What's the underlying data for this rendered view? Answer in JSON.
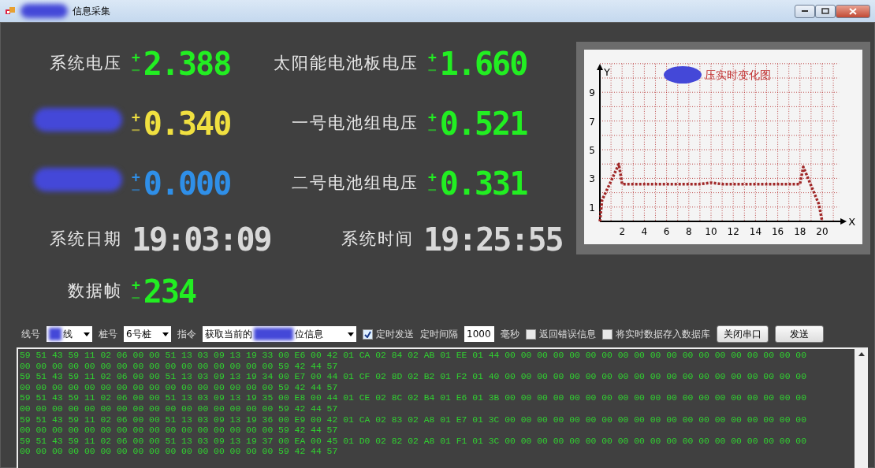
{
  "window": {
    "title": "信息采集"
  },
  "readouts": [
    {
      "label": "系统电压",
      "value": "2.388",
      "color": "#22ee22",
      "positive": true,
      "plus": "+",
      "minus": "−"
    },
    {
      "label": "太阳能电池板电压",
      "value": "1.660",
      "color": "#22ee22",
      "positive": true,
      "plus": "+",
      "minus": "−"
    },
    {
      "label_redacted": true,
      "value": "0.340",
      "color": "#f0e040",
      "positive": true,
      "plus": "+",
      "minus": "−"
    },
    {
      "label": "一号电池组电压",
      "value": "0.521",
      "color": "#22ee22",
      "positive": true,
      "plus": "+",
      "minus": "−"
    },
    {
      "label_redacted": true,
      "value": "0.000",
      "color": "#2f8fe8",
      "positive": true,
      "plus": "+",
      "minus": "−"
    },
    {
      "label": "二号电池组电压",
      "value": "0.331",
      "color": "#22ee22",
      "positive": true,
      "plus": "+",
      "minus": "−"
    }
  ],
  "date": {
    "label": "系统日期",
    "value": "19:03:09"
  },
  "time": {
    "label": "系统时间",
    "value": "19:25:55"
  },
  "frame": {
    "label": "数据帧",
    "value": "234",
    "color": "#22ee22",
    "positive": true,
    "plus": "+",
    "minus": "−"
  },
  "chart": {
    "chart_data": {
      "type": "line",
      "title": "压实时变化图",
      "xlabel": "X",
      "ylabel": "Y",
      "x": [
        0,
        0.2,
        1,
        1.7,
        2,
        4,
        9,
        10,
        11,
        18,
        18.3,
        19,
        19.7,
        20
      ],
      "grid": true,
      "series": [
        {
          "color": "#a02828",
          "line_style": "dotted",
          "values": [
            0,
            1.5,
            2.8,
            4,
            2.6,
            2.6,
            2.6,
            2.7,
            2.6,
            2.6,
            3.8,
            2.5,
            1.2,
            0
          ]
        }
      ],
      "xlim": [
        0,
        21
      ],
      "ylim": [
        0,
        11
      ],
      "xticks": [
        2,
        4,
        6,
        8,
        10,
        12,
        14,
        16,
        18,
        20
      ],
      "yticks": [
        1,
        3,
        5,
        7,
        9
      ]
    }
  },
  "controls": {
    "line": {
      "label": "线号",
      "value": "线"
    },
    "pile": {
      "label": "桩号",
      "value": "6号桩"
    },
    "command": {
      "label": "指令",
      "value_before": "获取当前的",
      "value_after": "位信息"
    },
    "timed_send": {
      "label": "定时发送",
      "checked": true
    },
    "interval": {
      "label": "定时间隔",
      "value": "1000",
      "unit": "毫秒"
    },
    "return_errors": {
      "label": "返回错误信息",
      "checked": false
    },
    "save_db": {
      "label": "将实时数据存入数据库",
      "checked": false
    },
    "buttons": [
      "关闭串口",
      "发送"
    ]
  },
  "log": [
    "59 51 43 59 11 02 06 00 00 51 13 03 09 13 19 33 00 E6 00 42 01 CA 02 84 02 AB 01 EE 01 44 00 00 00 00 00 00 00 00 00 00 00 00 00 00 00 00 00 00 00",
    "00 00 00 00 00 00 00 00 00 00 00 00 00 00 00 00 59 42 44 57",
    "59 51 43 59 11 02 06 00 00 51 13 03 09 13 19 34 00 E7 00 44 01 CF 02 8D 02 B2 01 F2 01 40 00 00 00 00 00 00 00 00 00 00 00 00 00 00 00 00 00 00 00",
    "00 00 00 00 00 00 00 00 00 00 00 00 00 00 00 00 59 42 44 57",
    "59 51 43 59 11 02 06 00 00 51 13 03 09 13 19 35 00 E8 00 44 01 CE 02 8C 02 B4 01 E6 01 3B 00 00 00 00 00 00 00 00 00 00 00 00 00 00 00 00 00 00 00",
    "00 00 00 00 00 00 00 00 00 00 00 00 00 00 00 00 59 42 44 57",
    "59 51 43 59 11 02 06 00 00 51 13 03 09 13 19 36 00 E9 00 42 01 CA 02 83 02 A8 01 E7 01 3C 00 00 00 00 00 00 00 00 00 00 00 00 00 00 00 00 00 00 00",
    "00 00 00 00 00 00 00 00 00 00 00 00 00 00 00 00 59 42 44 57",
    "59 51 43 59 11 02 06 00 00 51 13 03 09 13 19 37 00 EA 00 45 01 D0 02 82 02 A8 01 F1 01 3C 00 00 00 00 00 00 00 00 00 00 00 00 00 00 00 00 00 00 00",
    "00 00 00 00 00 00 00 00 00 00 00 00 00 00 00 00 59 42 44 57"
  ]
}
